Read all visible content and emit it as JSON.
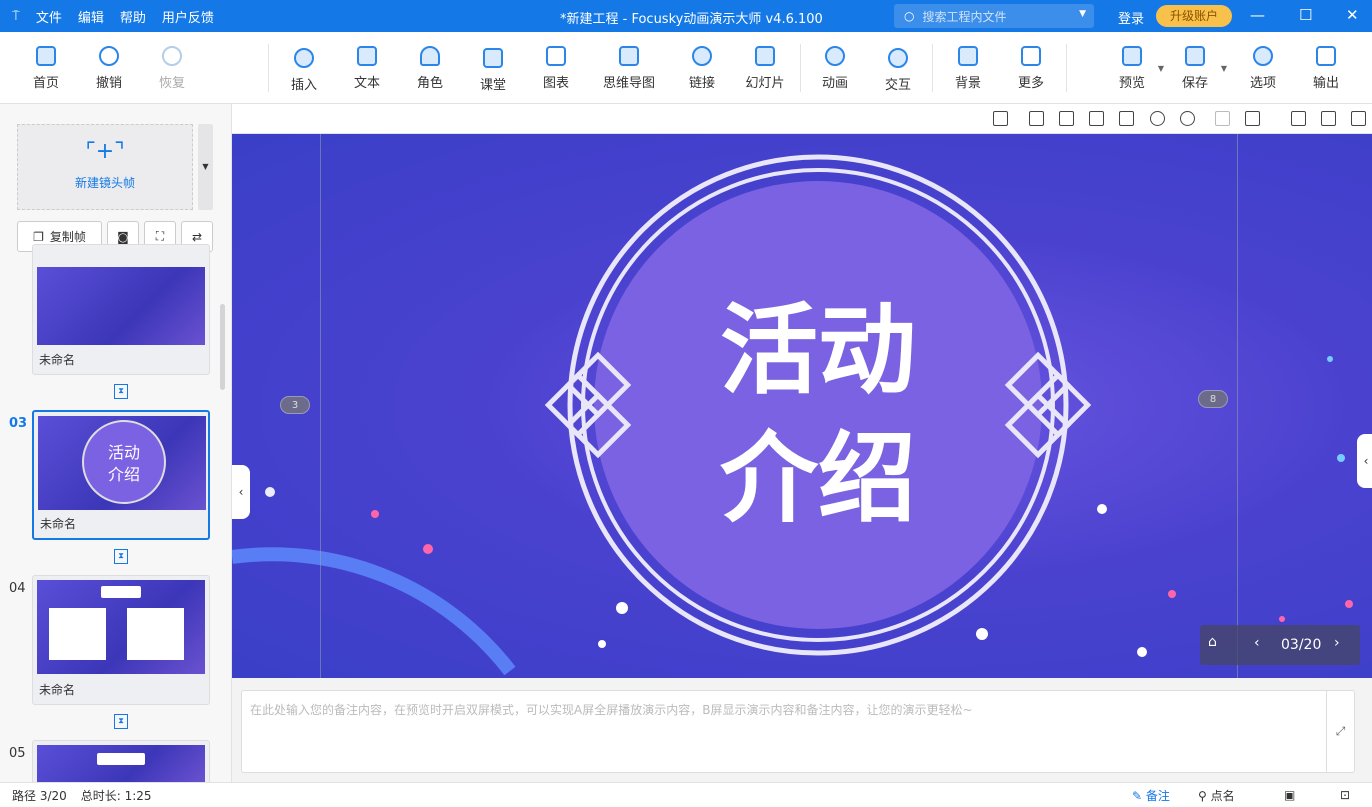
{
  "titlebar": {
    "menu": [
      "文件",
      "编辑",
      "帮助",
      "用户反馈"
    ],
    "title": "*新建工程 - Focusky动画演示大师  v4.6.100",
    "search_placeholder": "搜索工程内文件",
    "login": "登录",
    "upgrade": "升级账户"
  },
  "toolbar": {
    "items": [
      "首页",
      "撤销",
      "恢复",
      "插入",
      "文本",
      "角色",
      "课堂",
      "图表",
      "思维导图",
      "链接",
      "幻灯片",
      "动画",
      "交互",
      "背景",
      "更多",
      "预览",
      "保存",
      "选项",
      "输出"
    ]
  },
  "left": {
    "new_frame": "新建镜头帧",
    "copy_frame": "复制帧",
    "frames": [
      {
        "num": "",
        "label": "未命名"
      },
      {
        "num": "03",
        "label": "未命名"
      },
      {
        "num": "04",
        "label": "未命名"
      },
      {
        "num": "05",
        "label": ""
      }
    ]
  },
  "slide": {
    "line1": "活动",
    "line2": "介绍",
    "marker_left": "3",
    "marker_right": "8",
    "page": "03/20"
  },
  "notes": {
    "placeholder": "在此处输入您的备注内容，在预览时开启双屏模式，可以实现A屏全屏播放演示内容，B屏显示演示内容和备注内容，让您的演示更轻松~"
  },
  "status": {
    "path": "路径 3/20",
    "duration": "总时长: 1:25",
    "notes": "备注",
    "rollcall": "点名"
  },
  "colors": {
    "accent": "#1479e6",
    "upgrade": "#f8c14b"
  }
}
